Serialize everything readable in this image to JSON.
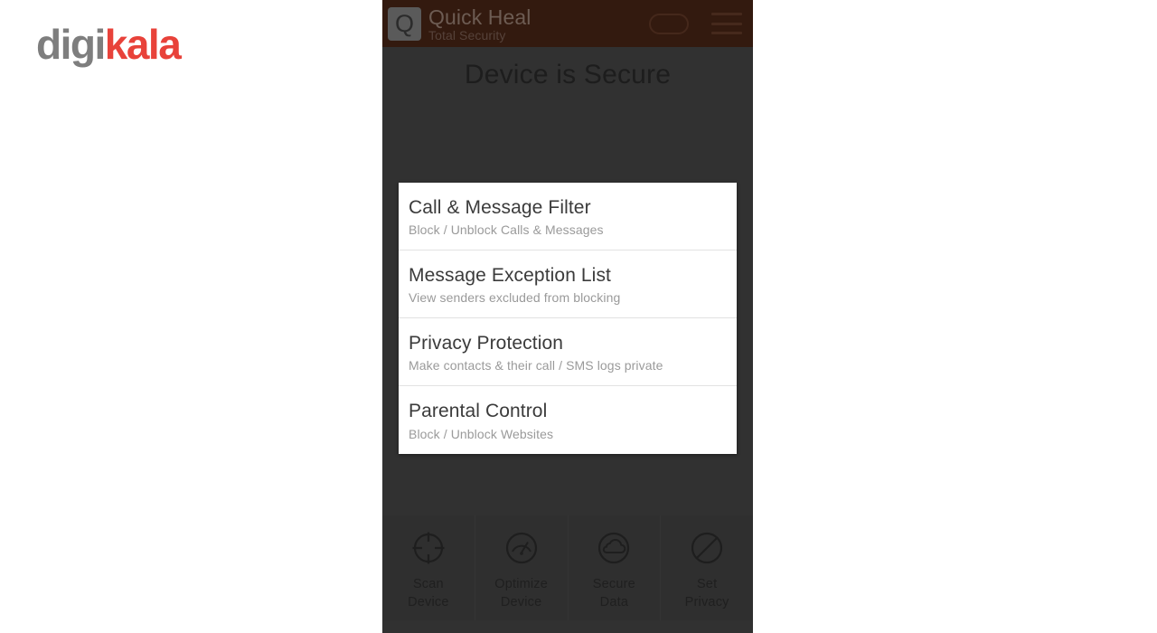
{
  "brand": {
    "name_part1": "digi",
    "name_part2": "kala",
    "color_gray": "#7e7e7e",
    "color_red": "#e8423a"
  },
  "app": {
    "logo_letter": "Q",
    "title": "Quick Heal",
    "subtitle": "Total Security",
    "header_bg": "#331a0f",
    "toggle_icon": "pill-toggle-icon",
    "menu_icon": "hamburger-menu-icon"
  },
  "status": {
    "heading": "Device is Secure"
  },
  "feature_card": {
    "rows": [
      {
        "title": "Call & Message Filter",
        "subtitle": "Block / Unblock Calls & Messages"
      },
      {
        "title": "Message Exception List",
        "subtitle": "View senders excluded from blocking"
      },
      {
        "title": "Privacy Protection",
        "subtitle": "Make contacts & their call / SMS logs private"
      },
      {
        "title": "Parental Control",
        "subtitle": "Block / Unblock Websites"
      }
    ]
  },
  "bottom_bar": {
    "tiles": [
      {
        "icon": "crosshair-target-icon",
        "line1": "Scan",
        "line2": "Device"
      },
      {
        "icon": "speedometer-gauge-icon",
        "line1": "Optimize",
        "line2": "Device"
      },
      {
        "icon": "cloud-icon",
        "line1": "Secure",
        "line2": "Data"
      },
      {
        "icon": "circle-slash-ban-icon",
        "line1": "Set",
        "line2": "Privacy"
      }
    ]
  }
}
